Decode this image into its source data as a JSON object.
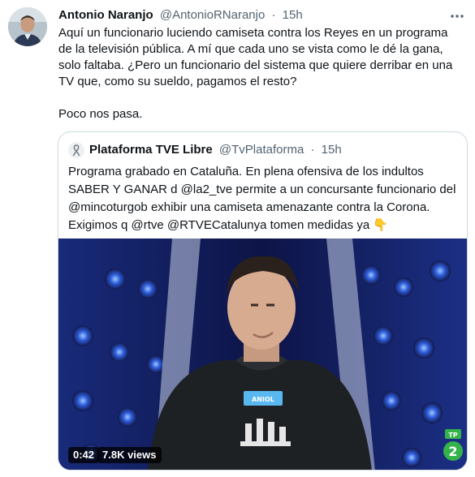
{
  "tweet": {
    "author_name": "Antonio Naranjo",
    "author_handle": "@AntonioRNaranjo",
    "separator": "·",
    "time": "15h",
    "text_p1": "Aquí un funcionario luciendo camiseta contra los Reyes en un programa de la televisión pública. A mí que cada uno se vista como le dé la gana, solo faltaba. ¿Pero un funcionario del sistema que quiere derribar en una TV que, como su sueldo, pagamos el resto?",
    "text_p2": "Poco nos pasa.",
    "more_icon": "more-horizontal-icon"
  },
  "quoted": {
    "author_name": "Plataforma TVE Libre",
    "author_handle": "@TvPlataforma",
    "separator": "·",
    "time": "15h",
    "avatar_icon": "ribbon-icon",
    "text": "Programa grabado en Cataluña. En plena ofensiva de los indultos SABER Y GANAR d @la2_tve permite a un concursante funcionario del @mincoturgob exhibir una camiseta amenazante contra la Corona. Exigimos q @rtve @RTVECatalunya tomen medidas ya",
    "emoji": "👇",
    "video": {
      "duration": "0:42",
      "views": "7.8K views",
      "channel_logo_text": "TP",
      "channel_number": "2",
      "name_tag": "ANIOL"
    }
  },
  "colors": {
    "text_primary": "#0f1419",
    "text_secondary": "#536471",
    "border": "#cfd9de",
    "channel_green": "#34b34a"
  }
}
